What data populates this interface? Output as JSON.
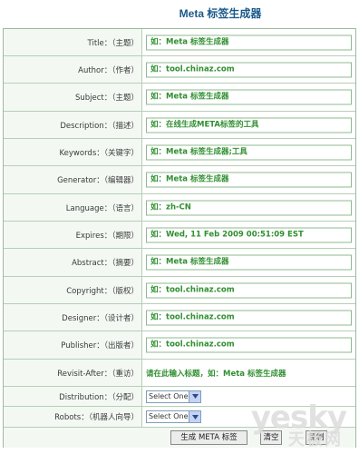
{
  "page": {
    "title": "Meta 标签生成器"
  },
  "fields": [
    {
      "label": "Title：（主题）",
      "value": "如：Meta 标签生成器"
    },
    {
      "label": "Author：（作者）",
      "value": "如：tool.chinaz.com"
    },
    {
      "label": "Subject：（主题）",
      "value": "如：Meta 标签生成器"
    },
    {
      "label": "Description：（描述）",
      "value": "如：在线生成META标签的工具"
    },
    {
      "label": "Keywords：（关键字）",
      "value": "如：Meta 标签生成器;工具"
    },
    {
      "label": "Generator：（编辑器）",
      "value": "如：Meta 标签生成器"
    },
    {
      "label": "Language：（语言）",
      "value": "如：zh-CN"
    },
    {
      "label": "Expires：（期限）",
      "value": "如：Wed, 11 Feb 2009 00:51:09 EST"
    },
    {
      "label": "Abstract：（摘要）",
      "value": "如：Meta 标签生成器"
    },
    {
      "label": "Copyright：（版权）",
      "value": "如：tool.chinaz.com"
    },
    {
      "label": "Designer：（设计者）",
      "value": "如：tool.chinaz.com"
    },
    {
      "label": "Publisher：（出版者）",
      "value": "如：tool.chinaz.com"
    }
  ],
  "revisit": {
    "label": "Revisit-After：（重访）",
    "value": "请在此输入标题，如：Meta 标签生成器"
  },
  "selects": [
    {
      "label": "Distribution：（分配）",
      "selected": "Select One"
    },
    {
      "label": "Robots：（机器人向导）",
      "selected": "Select One"
    }
  ],
  "buttons": {
    "generate": "生成 META 标签",
    "clear": "清空",
    "copy": "复制"
  },
  "watermark": {
    "brand": "yesky",
    "cn": "天极网"
  },
  "colors": {
    "accent": "#2f8f2f",
    "title": "#1b5a8a",
    "border": "#b6cfb6"
  }
}
